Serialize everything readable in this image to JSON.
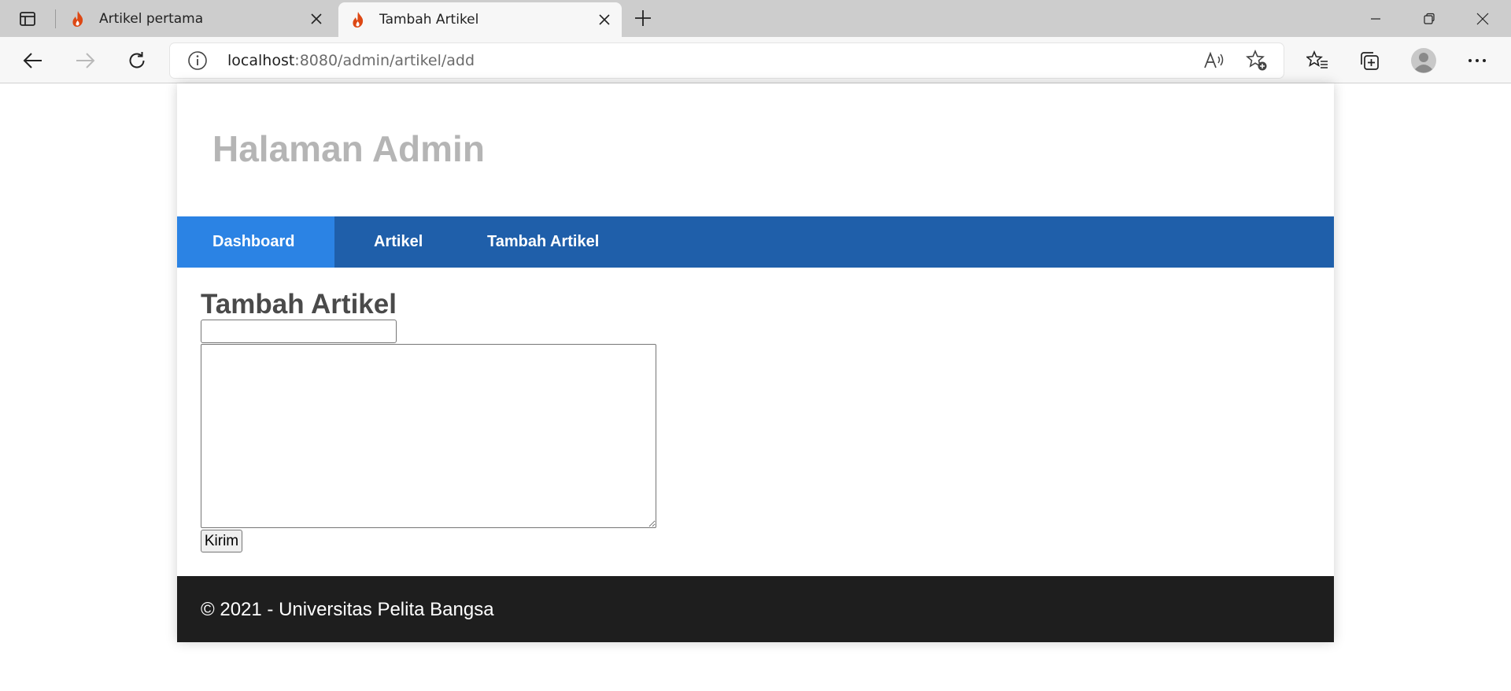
{
  "browser": {
    "tabs": [
      {
        "title": "Artikel pertama",
        "active": false
      },
      {
        "title": "Tambah Artikel",
        "active": true
      }
    ],
    "address": {
      "host": "localhost",
      "path": ":8080/admin/artikel/add"
    }
  },
  "page": {
    "site_title": "Halaman Admin",
    "nav": [
      {
        "label": "Dashboard",
        "active": true
      },
      {
        "label": "Artikel",
        "active": false
      },
      {
        "label": "Tambah Artikel",
        "active": false
      }
    ],
    "form": {
      "heading": "Tambah Artikel",
      "title_value": "",
      "content_value": "",
      "submit_label": "Kirim"
    },
    "footer": "© 2021 - Universitas Pelita Bangsa"
  },
  "colors": {
    "nav_bg": "#1f5faa",
    "nav_active": "#2b83e4",
    "footer_bg": "#1e1e1e",
    "site_title": "#b5b5b5"
  }
}
